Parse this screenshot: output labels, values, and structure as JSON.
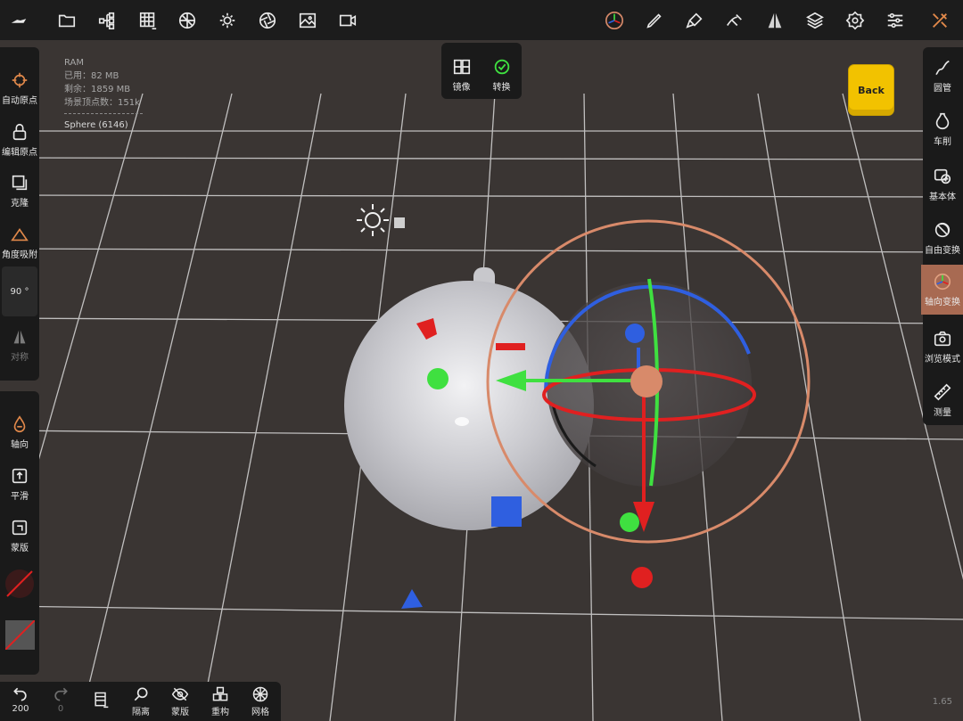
{
  "topbar": {
    "left_icons": [
      "logo-icon",
      "folder-icon",
      "scene-tree-icon",
      "grid-icon",
      "material-icon",
      "light-icon",
      "camera-icon",
      "image-icon",
      "video-icon"
    ],
    "right_icons": [
      "gizmo-icon",
      "brush-icon",
      "paint-icon",
      "sculpt-icon",
      "symmetry-icon",
      "layers-icon",
      "settings-icon",
      "sliders-icon",
      "tools-icon"
    ]
  },
  "info": {
    "ram_label": "RAM",
    "used": "已用：82 MB",
    "free": "剩余：1859 MB",
    "vertices": "场景顶点数：151k",
    "object": "Sphere (6146)"
  },
  "mirror_panel": {
    "mirror": "镜像",
    "convert": "转换"
  },
  "left_tools": {
    "auto_origin": "自动原点",
    "edit_origin": "编辑原点",
    "clone": "克隆",
    "angle_snap": "角度吸附",
    "angle_value": "90 °",
    "symmetry": "对称"
  },
  "left_tools2": {
    "axis": "轴向",
    "smooth": "平滑",
    "mask": "蒙版"
  },
  "back_button": "Back",
  "right_tools": {
    "tube": "圆管",
    "lathe": "车削",
    "primitive": "基本体",
    "free_transform": "自由变换",
    "axis_transform": "轴向变换",
    "view_mode": "浏览模式",
    "measure": "测量"
  },
  "bottom": {
    "undo_count": "200",
    "redo_count": "0",
    "isolate": "隔离",
    "mask_view": "蒙版",
    "remesh": "重构",
    "wireframe": "网格"
  },
  "version": "1.65",
  "colors": {
    "accent": "#a86a52",
    "gizmo_x": "#e02020",
    "gizmo_y": "#3fe040",
    "gizmo_z": "#2f5fe0",
    "ring": "#d88a6a",
    "back": "#f2c200"
  }
}
